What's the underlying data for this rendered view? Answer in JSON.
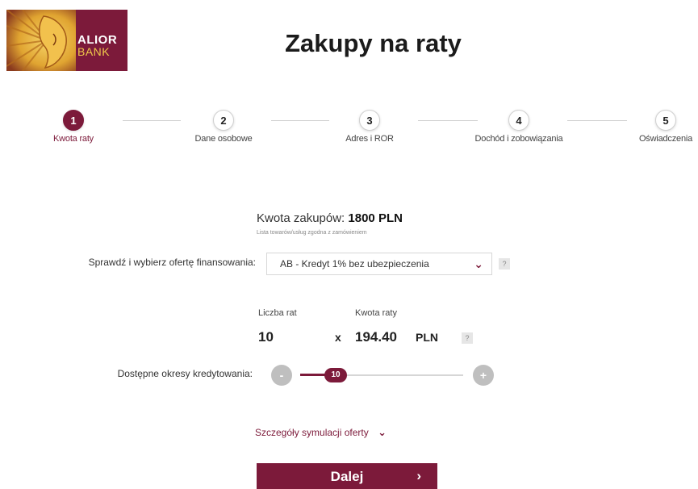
{
  "brand": {
    "name": "ALIOR",
    "sub": "BANK",
    "color": "#7c1a3a"
  },
  "page_title": "Zakupy na raty",
  "steps": [
    {
      "num": "1",
      "label": "Kwota raty",
      "active": true
    },
    {
      "num": "2",
      "label": "Dane osobowe",
      "active": false
    },
    {
      "num": "3",
      "label": "Adres i ROR",
      "active": false
    },
    {
      "num": "4",
      "label": "Dochód i zobowiązania",
      "active": false
    },
    {
      "num": "5",
      "label": "Oświadczenia",
      "active": false
    }
  ],
  "amount": {
    "label": "Kwota zakupów:",
    "value": "1800 PLN",
    "note": "Lista towarów/usług zgodna z zamówieniem"
  },
  "offer": {
    "label": "Sprawdź i wybierz ofertę finansowania:",
    "selected": "AB - Kredyt 1% bez ubezpieczenia",
    "help": "?"
  },
  "calc": {
    "installments_label": "Liczba rat",
    "rate_label": "Kwota raty",
    "installments": "10",
    "times": "x",
    "rate": "194.40",
    "currency": "PLN",
    "help": "?"
  },
  "period": {
    "label": "Dostępne okresy kredytowania:",
    "minus": "-",
    "plus": "+",
    "value": "10"
  },
  "details_label": "Szczegóły symulacji oferty",
  "next_label": "Dalej"
}
